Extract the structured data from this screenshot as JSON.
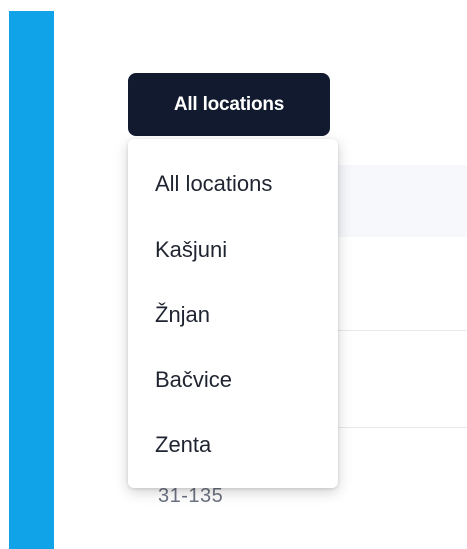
{
  "location_filter": {
    "selected_label": "All locations",
    "options": [
      {
        "label": "All locations"
      },
      {
        "label": "Kašjuni"
      },
      {
        "label": "Žnjan"
      },
      {
        "label": "Bačvice"
      },
      {
        "label": "Zenta"
      }
    ]
  },
  "table": {
    "partial_cell_text": "31-135"
  },
  "colors": {
    "sidebar_accent": "#11a3e8",
    "trigger_bg": "#111a2e",
    "menu_text": "#1f2430"
  }
}
